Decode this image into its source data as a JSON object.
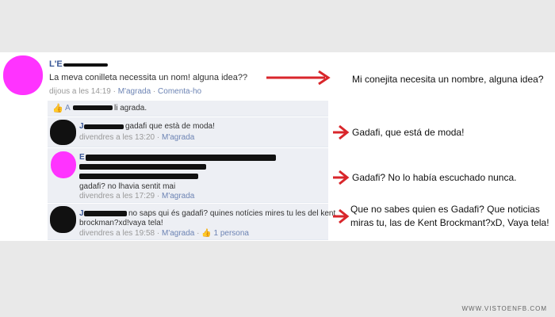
{
  "post": {
    "author": "L'E",
    "text": "La meva conilleta necessita un nom! alguna idea??",
    "time": "dijous a les 14:19",
    "like_link": "M'agrada",
    "comment_link": "Comenta-ho",
    "separator": "·"
  },
  "likes": {
    "prefix": "A",
    "suffix": "li agrada."
  },
  "comments": [
    {
      "author": "J",
      "text": "gadafi que està de moda!",
      "time": "divendres a les 13:20",
      "like_link": "M'agrada"
    },
    {
      "author": "E",
      "text": "gadafi? no lhavia sentit mai",
      "time": "divendres a les 17:29",
      "like_link": "M'agrada"
    },
    {
      "author": "J",
      "text_line1": "no saps qui és gadafi? quines notícies mires tu les del kent",
      "text_line2": "brockman?xd!vaya tela!",
      "time": "divendres a les 19:58",
      "like_link": "M'agrada",
      "likes_count": "1 persona"
    }
  ],
  "translations": [
    "Mi conejita necesita un nombre, alguna idea?",
    "Gadafi, que está de moda!",
    "Gadafi? No lo había escuchado nunca.",
    "Que no sabes quien es Gadafi? Que noticias",
    "miras tu, las de Kent Brockmant?xD, Vaya tela!"
  ],
  "footer": "WWW.VISTOENFB.COM",
  "colors": {
    "arrow": "#d9262b",
    "avatar": "#ff33ff",
    "link": "#6d84b4",
    "name": "#3b5998"
  }
}
